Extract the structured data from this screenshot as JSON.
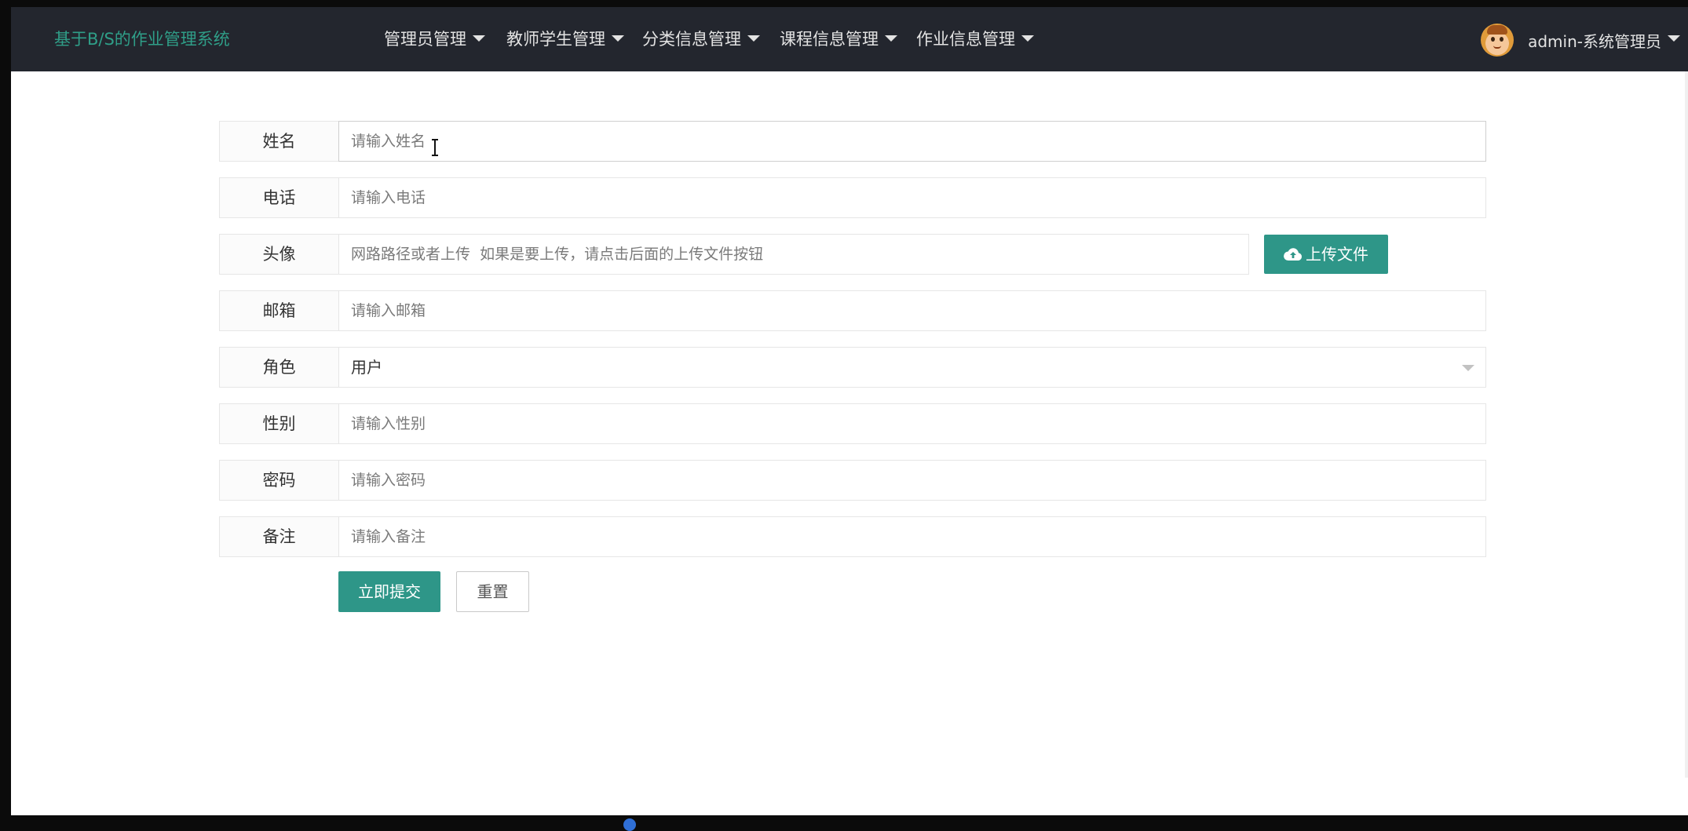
{
  "navbar": {
    "brand": "基于B/S的作业管理系统",
    "menus": [
      {
        "label": "管理员管理"
      },
      {
        "label": "教师学生管理"
      },
      {
        "label": "分类信息管理"
      },
      {
        "label": "课程信息管理"
      },
      {
        "label": "作业信息管理"
      }
    ],
    "user": {
      "label": "admin-系统管理员"
    }
  },
  "form": {
    "name": {
      "label": "姓名",
      "placeholder": "请输入姓名",
      "value": ""
    },
    "phone": {
      "label": "电话",
      "placeholder": "请输入电话",
      "value": ""
    },
    "avatar": {
      "label": "头像",
      "placeholder": "网路路径或者上传  如果是要上传，请点击后面的上传文件按钮",
      "value": "",
      "upload_label": "上传文件"
    },
    "email": {
      "label": "邮箱",
      "placeholder": "请输入邮箱",
      "value": ""
    },
    "role": {
      "label": "角色",
      "selected": "用户"
    },
    "gender": {
      "label": "性别",
      "placeholder": "请输入性别",
      "value": ""
    },
    "password": {
      "label": "密码",
      "placeholder": "请输入密码",
      "value": ""
    },
    "remark": {
      "label": "备注",
      "placeholder": "请输入备注",
      "value": ""
    },
    "submit_label": "立即提交",
    "reset_label": "重置"
  },
  "colors": {
    "navbar_bg": "#23262e",
    "brand": "#2f9e88",
    "primary_button": "#2e9688"
  }
}
